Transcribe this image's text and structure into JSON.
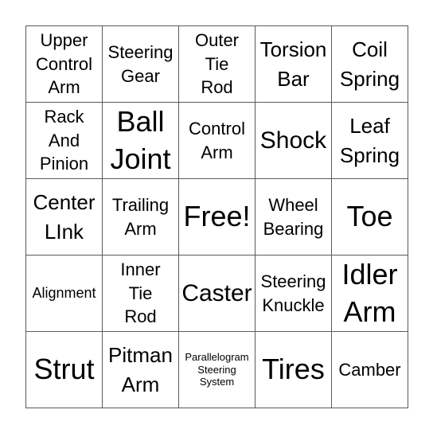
{
  "board": {
    "cells": [
      {
        "label": "Upper\nControl\nArm",
        "size": "s-md"
      },
      {
        "label": "Steering\nGear",
        "size": "s-md"
      },
      {
        "label": "Outer\nTie\nRod",
        "size": "s-md"
      },
      {
        "label": "Torsion\nBar",
        "size": "s-lg"
      },
      {
        "label": "Coil\nSpring",
        "size": "s-lg"
      },
      {
        "label": "Rack\nAnd\nPinion",
        "size": "s-md"
      },
      {
        "label": "Ball\nJoint",
        "size": "s-xxl"
      },
      {
        "label": "Control\nArm",
        "size": "s-md"
      },
      {
        "label": "Shock",
        "size": "s-xl"
      },
      {
        "label": "Leaf\nSpring",
        "size": "s-lg"
      },
      {
        "label": "Center\nLInk",
        "size": "s-lg"
      },
      {
        "label": "Trailing\nArm",
        "size": "s-md"
      },
      {
        "label": "Free!",
        "size": "s-xxl"
      },
      {
        "label": "Wheel\nBearing",
        "size": "s-md"
      },
      {
        "label": "Toe",
        "size": "s-xxl"
      },
      {
        "label": "Alignment",
        "size": "s-sm"
      },
      {
        "label": "Inner\nTie\nRod",
        "size": "s-md"
      },
      {
        "label": "Caster",
        "size": "s-xl"
      },
      {
        "label": "Steering\nKnuckle",
        "size": "s-md"
      },
      {
        "label": "Idler\nArm",
        "size": "s-xxl"
      },
      {
        "label": "Strut",
        "size": "s-xxl"
      },
      {
        "label": "Pitman\nArm",
        "size": "s-lg"
      },
      {
        "label": "Parallelogram\nSteering\nSystem",
        "size": "s-xs"
      },
      {
        "label": "Tires",
        "size": "s-xxl"
      },
      {
        "label": "Camber",
        "size": "s-md"
      }
    ]
  }
}
